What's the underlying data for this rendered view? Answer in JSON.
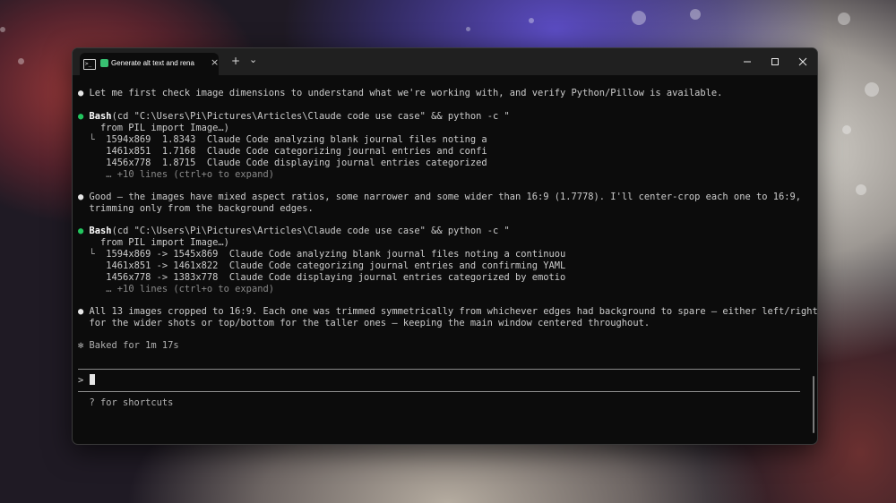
{
  "window": {
    "tab_title": "Generate alt text and rena",
    "tab_close": "×",
    "new_tab": "+",
    "dropdown": "⌄"
  },
  "terminal": {
    "line1_text": "Let me first check image dimensions to understand what we're working with, and verify Python/Pillow is available.",
    "bash1": {
      "label": "Bash",
      "args": "(cd \"C:\\Users\\Pi\\Pictures\\Articles\\Claude code use case\" && python -c \"",
      "cont": "    from PIL import Image…)",
      "out1": "  1594x869  1.8343  Claude Code analyzing blank journal files noting a",
      "out2": "  1461x851  1.7168  Claude Code categorizing journal entries and confi",
      "out3": "  1456x778  1.8715  Claude Code displaying journal entries categorized",
      "more": "  … +10 lines (ctrl+o to expand)"
    },
    "good_line1": "Good — the images have mixed aspect ratios, some narrower and some wider than 16:9 (1.7778). I'll center-crop each one to 16:9,",
    "good_line2": "trimming only from the background edges.",
    "bash2": {
      "label": "Bash",
      "args": "(cd \"C:\\Users\\Pi\\Pictures\\Articles\\Claude code use case\" && python -c \"",
      "cont": "    from PIL import Image…)",
      "out1": "  1594x869 -> 1545x869  Claude Code analyzing blank journal files noting a continuou",
      "out2": "  1461x851 -> 1461x822  Claude Code categorizing journal entries and confirming YAML",
      "out3": "  1456x778 -> 1383x778  Claude Code displaying journal entries categorized by emotio",
      "more": "  … +10 lines (ctrl+o to expand)"
    },
    "final_line1": "All 13 images cropped to 16:9. Each one was trimmed symmetrically from whichever edges had background to spare — either left/right",
    "final_line2": "for the wider shots or top/bottom for the taller ones — keeping the main window centered throughout.",
    "baked_symbol": "✻",
    "baked_text": "Baked for 1m 17s",
    "prompt_symbol": ">",
    "shortcuts_hint": "? for shortcuts",
    "bullet": "●",
    "tree_branch": "└"
  },
  "colors": {
    "bullet_success": "#22c55e",
    "terminal_bg": "#0c0c0c",
    "titlebar_bg": "#202020"
  },
  "icons": [
    "terminal-icon",
    "claude-icon",
    "close-icon",
    "plus-icon",
    "chevron-down-icon",
    "minimize-icon",
    "maximize-icon",
    "window-close-icon"
  ]
}
